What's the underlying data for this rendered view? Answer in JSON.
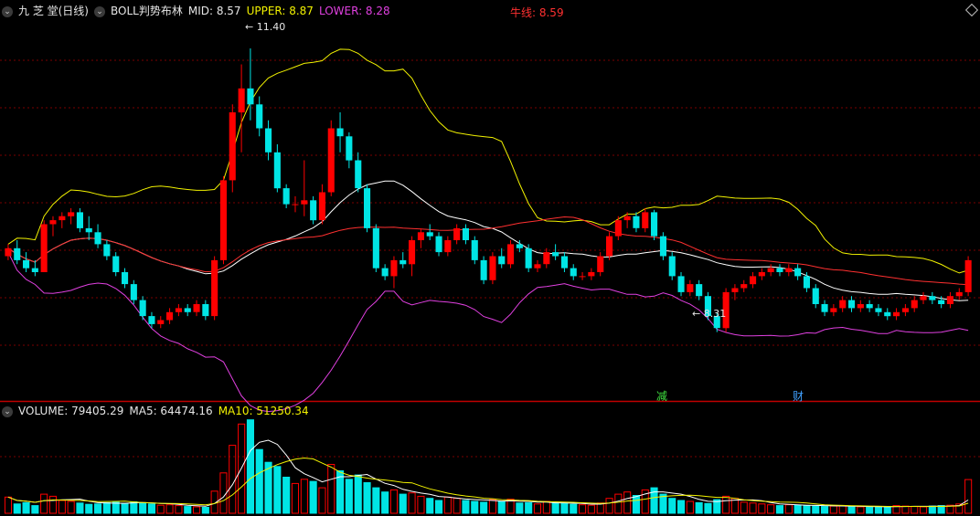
{
  "header": {
    "stock_name": "九 芝 堂(日线)",
    "indicator": "BOLL判势布林",
    "mid": "MID: 8.57",
    "upper": "UPPER: 8.87",
    "lower": "LOWER: 8.28",
    "bull_line": "牛线: 8.59"
  },
  "volume_header": {
    "volume": "VOLUME: 79405.29",
    "ma5": "MA5: 64474.16",
    "ma10": "MA10: 51250.34"
  },
  "annotations": {
    "high": "11.40",
    "low": "8.31"
  },
  "markers": [
    {
      "label": "减",
      "color": "#40e040"
    },
    {
      "label": "财",
      "color": "#40a0ff"
    }
  ],
  "colors": {
    "up": "#ff0000",
    "down": "#00e5e5",
    "boll_upper": "#f2f200",
    "boll_mid": "#ffffff",
    "boll_lower": "#e040e0",
    "bull_line": "#ff3030",
    "ma5": "#ffffff",
    "ma10": "#f2f200",
    "grid": "#7a0000",
    "divider": "#c00000"
  },
  "chart_data": {
    "type": "candlestick",
    "price_range": [
      7.0,
      11.8
    ],
    "volume_max": 230000,
    "ohlc": [
      [
        8.8,
        8.95,
        8.75,
        8.9
      ],
      [
        8.9,
        9.0,
        8.7,
        8.75
      ],
      [
        8.75,
        8.85,
        8.6,
        8.65
      ],
      [
        8.65,
        8.75,
        8.55,
        8.6
      ],
      [
        8.6,
        9.25,
        8.6,
        9.2
      ],
      [
        9.2,
        9.3,
        9.05,
        9.25
      ],
      [
        9.25,
        9.35,
        9.15,
        9.3
      ],
      [
        9.3,
        9.4,
        9.2,
        9.35
      ],
      [
        9.35,
        9.4,
        9.1,
        9.15
      ],
      [
        9.15,
        9.3,
        9.0,
        9.1
      ],
      [
        9.1,
        9.2,
        8.9,
        8.95
      ],
      [
        8.95,
        9.0,
        8.75,
        8.8
      ],
      [
        8.8,
        8.85,
        8.55,
        8.6
      ],
      [
        8.6,
        8.65,
        8.4,
        8.45
      ],
      [
        8.45,
        8.5,
        8.2,
        8.25
      ],
      [
        8.25,
        8.3,
        8.0,
        8.05
      ],
      [
        8.05,
        8.1,
        7.9,
        7.95
      ],
      [
        7.95,
        8.05,
        7.9,
        8.0
      ],
      [
        8.0,
        8.15,
        7.95,
        8.1
      ],
      [
        8.1,
        8.2,
        8.05,
        8.15
      ],
      [
        8.15,
        8.2,
        8.05,
        8.1
      ],
      [
        8.1,
        8.25,
        8.05,
        8.2
      ],
      [
        8.2,
        8.25,
        8.0,
        8.05
      ],
      [
        8.05,
        8.8,
        8.0,
        8.75
      ],
      [
        8.75,
        9.8,
        8.7,
        9.75
      ],
      [
        9.75,
        10.7,
        9.6,
        10.6
      ],
      [
        10.6,
        11.2,
        10.1,
        10.9
      ],
      [
        10.9,
        11.4,
        10.5,
        10.7
      ],
      [
        10.7,
        10.8,
        10.3,
        10.4
      ],
      [
        10.4,
        10.5,
        10.0,
        10.1
      ],
      [
        10.1,
        10.2,
        9.6,
        9.65
      ],
      [
        9.65,
        9.7,
        9.4,
        9.45
      ],
      [
        9.45,
        9.55,
        9.35,
        9.45
      ],
      [
        9.45,
        10.0,
        9.3,
        9.5
      ],
      [
        9.5,
        9.55,
        9.2,
        9.25
      ],
      [
        9.25,
        9.7,
        9.2,
        9.6
      ],
      [
        9.6,
        10.5,
        9.55,
        10.4
      ],
      [
        10.4,
        10.6,
        10.1,
        10.3
      ],
      [
        10.3,
        10.35,
        9.9,
        10.0
      ],
      [
        10.0,
        10.1,
        9.6,
        9.65
      ],
      [
        9.65,
        9.7,
        9.1,
        9.15
      ],
      [
        9.15,
        9.2,
        8.6,
        8.65
      ],
      [
        8.65,
        8.7,
        8.5,
        8.55
      ],
      [
        8.55,
        8.8,
        8.4,
        8.75
      ],
      [
        8.75,
        8.85,
        8.65,
        8.7
      ],
      [
        8.7,
        9.05,
        8.55,
        9.0
      ],
      [
        9.0,
        9.15,
        8.9,
        9.1
      ],
      [
        9.1,
        9.2,
        9.0,
        9.05
      ],
      [
        9.05,
        9.1,
        8.8,
        8.85
      ],
      [
        8.85,
        9.05,
        8.8,
        9.0
      ],
      [
        9.0,
        9.2,
        8.95,
        9.15
      ],
      [
        9.15,
        9.2,
        8.95,
        9.0
      ],
      [
        9.0,
        9.05,
        8.7,
        8.75
      ],
      [
        8.75,
        8.8,
        8.45,
        8.5
      ],
      [
        8.5,
        8.85,
        8.45,
        8.8
      ],
      [
        8.8,
        8.9,
        8.65,
        8.7
      ],
      [
        8.7,
        9.0,
        8.65,
        8.95
      ],
      [
        8.95,
        9.0,
        8.85,
        8.9
      ],
      [
        8.9,
        8.95,
        8.6,
        8.65
      ],
      [
        8.65,
        8.75,
        8.6,
        8.7
      ],
      [
        8.7,
        8.9,
        8.65,
        8.85
      ],
      [
        8.85,
        8.95,
        8.75,
        8.8
      ],
      [
        8.8,
        8.85,
        8.6,
        8.65
      ],
      [
        8.65,
        8.7,
        8.5,
        8.55
      ],
      [
        8.55,
        8.6,
        8.5,
        8.55
      ],
      [
        8.55,
        8.65,
        8.5,
        8.6
      ],
      [
        8.6,
        8.85,
        8.55,
        8.8
      ],
      [
        8.8,
        9.1,
        8.75,
        9.05
      ],
      [
        9.05,
        9.3,
        9.0,
        9.25
      ],
      [
        9.25,
        9.35,
        9.15,
        9.3
      ],
      [
        9.3,
        9.35,
        9.1,
        9.15
      ],
      [
        9.15,
        9.4,
        9.1,
        9.35
      ],
      [
        9.35,
        9.38,
        9.0,
        9.05
      ],
      [
        9.05,
        9.1,
        8.75,
        8.8
      ],
      [
        8.8,
        8.85,
        8.5,
        8.55
      ],
      [
        8.55,
        8.6,
        8.3,
        8.35
      ],
      [
        8.35,
        8.5,
        8.3,
        8.45
      ],
      [
        8.45,
        8.5,
        8.25,
        8.3
      ],
      [
        8.3,
        8.35,
        8.0,
        8.05
      ],
      [
        8.05,
        8.1,
        7.85,
        7.9
      ],
      [
        7.9,
        8.4,
        7.85,
        8.35
      ],
      [
        8.35,
        8.45,
        8.25,
        8.4
      ],
      [
        8.4,
        8.5,
        8.35,
        8.45
      ],
      [
        8.45,
        8.6,
        8.4,
        8.55
      ],
      [
        8.55,
        8.65,
        8.5,
        8.6
      ],
      [
        8.6,
        8.7,
        8.55,
        8.65
      ],
      [
        8.65,
        8.7,
        8.55,
        8.6
      ],
      [
        8.6,
        8.7,
        8.55,
        8.65
      ],
      [
        8.65,
        8.7,
        8.5,
        8.55
      ],
      [
        8.55,
        8.6,
        8.35,
        8.4
      ],
      [
        8.4,
        8.45,
        8.15,
        8.2
      ],
      [
        8.2,
        8.25,
        8.05,
        8.1
      ],
      [
        8.1,
        8.2,
        8.05,
        8.15
      ],
      [
        8.15,
        8.3,
        8.1,
        8.25
      ],
      [
        8.25,
        8.3,
        8.1,
        8.15
      ],
      [
        8.15,
        8.25,
        8.1,
        8.2
      ],
      [
        8.2,
        8.25,
        8.1,
        8.15
      ],
      [
        8.15,
        8.2,
        8.05,
        8.1
      ],
      [
        8.1,
        8.15,
        8.0,
        8.05
      ],
      [
        8.05,
        8.15,
        8.0,
        8.1
      ],
      [
        8.1,
        8.2,
        8.05,
        8.15
      ],
      [
        8.15,
        8.3,
        8.1,
        8.25
      ],
      [
        8.25,
        8.35,
        8.2,
        8.3
      ],
      [
        8.3,
        8.35,
        8.2,
        8.25
      ],
      [
        8.25,
        8.3,
        8.15,
        8.2
      ],
      [
        8.2,
        8.35,
        8.15,
        8.3
      ],
      [
        8.3,
        8.4,
        8.25,
        8.35
      ],
      [
        8.35,
        8.8,
        8.3,
        8.75
      ]
    ],
    "volume": [
      38000,
      22000,
      25000,
      18000,
      45000,
      40000,
      30000,
      28000,
      24000,
      21000,
      22000,
      25000,
      26000,
      23000,
      27000,
      25000,
      22000,
      19000,
      20000,
      18000,
      16000,
      15000,
      14000,
      52000,
      95000,
      160000,
      210000,
      220000,
      150000,
      120000,
      110000,
      85000,
      70000,
      80000,
      75000,
      60000,
      115000,
      100000,
      80000,
      90000,
      72000,
      60000,
      50000,
      55000,
      45000,
      48000,
      40000,
      35000,
      30000,
      38000,
      35000,
      30000,
      28000,
      26000,
      32000,
      27000,
      33000,
      24000,
      25000,
      22000,
      28000,
      24000,
      23000,
      21000,
      20000,
      19000,
      24000,
      35000,
      45000,
      50000,
      42000,
      55000,
      60000,
      45000,
      35000,
      30000,
      28000,
      25000,
      23000,
      32000,
      40000,
      35000,
      26000,
      24000,
      22000,
      20000,
      18000,
      20000,
      19000,
      18000,
      17000,
      16000,
      17000,
      18000,
      16000,
      15000,
      14000,
      15000,
      16000,
      18000,
      17000,
      16000,
      15000,
      17000,
      18000,
      19000,
      22000,
      79405
    ],
    "legend_values": {
      "mid": 8.57,
      "upper": 8.87,
      "lower": 8.28,
      "bull_line": 8.59,
      "volume": 79405.29,
      "ma5": 64474.16,
      "ma10": 51250.34
    }
  }
}
